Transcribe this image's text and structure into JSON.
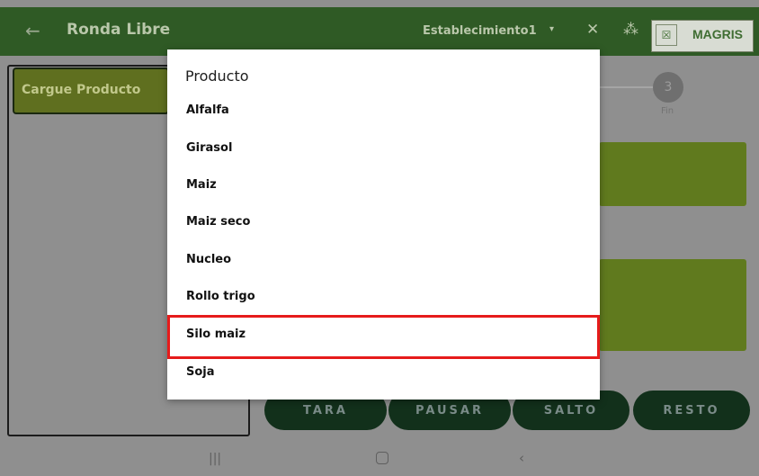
{
  "appbar": {
    "title": "Ronda Libre",
    "back_icon": "←",
    "establishment": "Establecimiento1",
    "dropdown_icon": "▾",
    "close_icon": "✕",
    "bluetooth_icon": "⁂",
    "logo_text": "MAGRIS",
    "logo_icon": "☒"
  },
  "left_panel": {
    "tag": "Cargue Producto"
  },
  "steps": {
    "number": "3",
    "label": "Fin"
  },
  "actions": {
    "tara": "TARA",
    "pausar": "PAUSAR",
    "salto": "SALTO",
    "resto": "RESTO"
  },
  "dialog": {
    "title": "Producto",
    "options": [
      "Alfalfa",
      "Girasol",
      "Maiz",
      "Maiz seco",
      "Nucleo",
      "Rollo trigo",
      "Silo maiz",
      "Soja"
    ],
    "highlighted": "Silo maiz"
  },
  "system_nav": {
    "recents": "|||",
    "home": "",
    "back": "‹"
  }
}
